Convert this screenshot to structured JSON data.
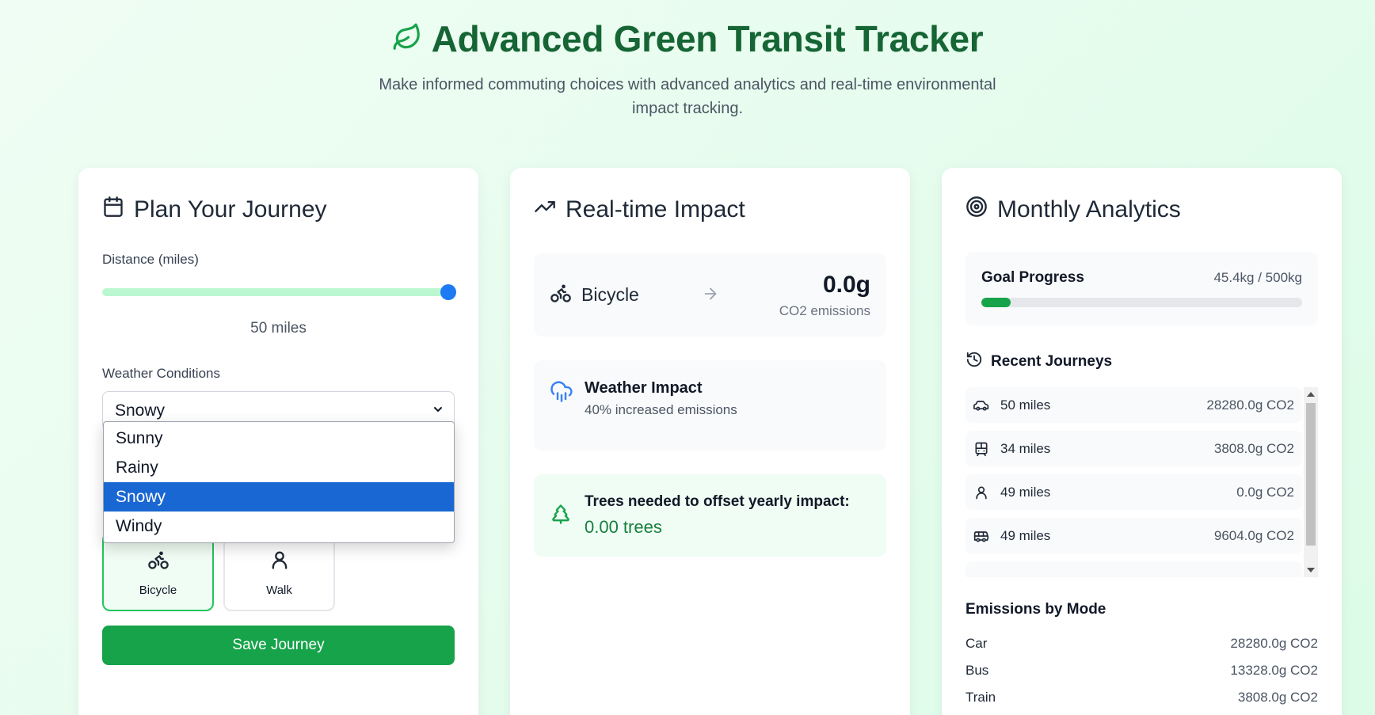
{
  "header": {
    "title": "Advanced Green Transit Tracker",
    "subtitle": "Make informed commuting choices with advanced analytics and real-time environmental impact tracking.",
    "icon": "leaf-icon"
  },
  "colors": {
    "brand": "#166534",
    "accent": "#16a34a",
    "slider_thumb": "#1d7af2",
    "dropdown_selected": "#1967d2"
  },
  "plan": {
    "title": "Plan Your Journey",
    "distance_label": "Distance (miles)",
    "distance_value": "50 miles",
    "distance_level": 1.0,
    "weather_label": "Weather Conditions",
    "weather_selected": "Snowy",
    "weather_options": [
      "Sunny",
      "Rainy",
      "Snowy",
      "Windy"
    ],
    "modes": [
      {
        "label": "Bicycle",
        "icon": "bicycle-icon",
        "active": true
      },
      {
        "label": "Walk",
        "icon": "walk-icon",
        "active": false
      }
    ],
    "save_label": "Save Journey"
  },
  "impact": {
    "title": "Real-time Impact",
    "mode": "Bicycle",
    "value": "0.0g",
    "value_sub": "CO2 emissions",
    "weather_title": "Weather Impact",
    "weather_sub": "40% increased emissions",
    "trees_title": "Trees needed to offset yearly impact:",
    "trees_value": "0.00 trees"
  },
  "analytics": {
    "title": "Monthly Analytics",
    "goal_label": "Goal Progress",
    "goal_value": "45.4kg / 500kg",
    "goal_fraction": 0.091,
    "recent_title": "Recent Journeys",
    "journeys": [
      {
        "icon": "car-icon",
        "distance": "50 miles",
        "co2": "28280.0g CO2"
      },
      {
        "icon": "train-icon",
        "distance": "34 miles",
        "co2": "3808.0g CO2"
      },
      {
        "icon": "walk-icon",
        "distance": "49 miles",
        "co2": "0.0g CO2"
      },
      {
        "icon": "bus-icon",
        "distance": "49 miles",
        "co2": "9604.0g CO2"
      }
    ],
    "emissions_title": "Emissions by Mode",
    "emissions": [
      {
        "mode": "Car",
        "value": "28280.0g CO2"
      },
      {
        "mode": "Bus",
        "value": "13328.0g CO2"
      },
      {
        "mode": "Train",
        "value": "3808.0g CO2"
      }
    ]
  }
}
